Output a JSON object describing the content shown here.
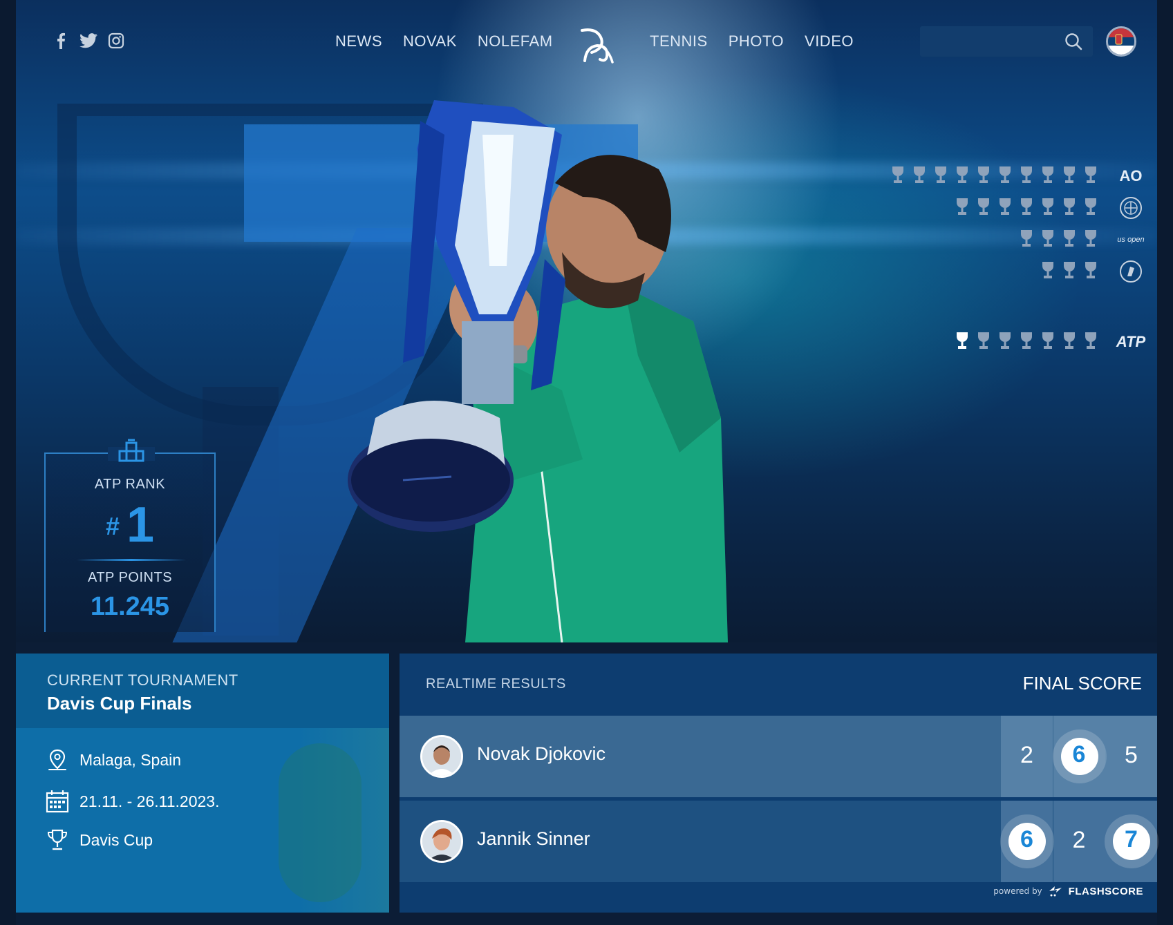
{
  "nav": {
    "left_items": [
      "NEWS",
      "NOVAK",
      "NOLEFAM"
    ],
    "right_items": [
      "TENNIS",
      "PHOTO",
      "VIDEO"
    ],
    "search_placeholder": ""
  },
  "social": [
    "facebook-icon",
    "twitter-icon",
    "instagram-icon"
  ],
  "trophies": {
    "ao": "AO",
    "usopen": "us open",
    "atp": "ATP",
    "rows": [
      {
        "name": "australian-open",
        "count": 10
      },
      {
        "name": "wimbledon",
        "count": 7
      },
      {
        "name": "us-open",
        "count": 4
      },
      {
        "name": "roland-garros",
        "count": 3
      },
      {
        "name": "atp-finals",
        "count": 7,
        "highlighted": 1
      }
    ]
  },
  "rank": {
    "rank_label": "ATP RANK",
    "hash": "#",
    "rank_value": "1",
    "points_label": "ATP POINTS",
    "points_value": "11.245"
  },
  "tournament": {
    "caption": "CURRENT TOURNAMENT",
    "name": "Davis Cup Finals",
    "location": "Malaga, Spain",
    "dates": "21.11. - 26.11.2023.",
    "competition": "Davis Cup"
  },
  "results": {
    "header": "REALTIME RESULTS",
    "status": "FINAL SCORE",
    "powered_by": "powered by",
    "provider": "FLASHSCORE",
    "players": [
      {
        "name": "Novak Djokovic",
        "sets": [
          "2",
          "6",
          "5"
        ],
        "wins": [
          false,
          true,
          false
        ]
      },
      {
        "name": "Jannik Sinner",
        "sets": [
          "6",
          "2",
          "7"
        ],
        "wins": [
          true,
          false,
          true
        ]
      }
    ]
  },
  "colors": {
    "accent": "#2b95e6",
    "panel_tournament": "#0e6ea8",
    "panel_results": "#0d3d70",
    "jacket": "#17a57e"
  }
}
